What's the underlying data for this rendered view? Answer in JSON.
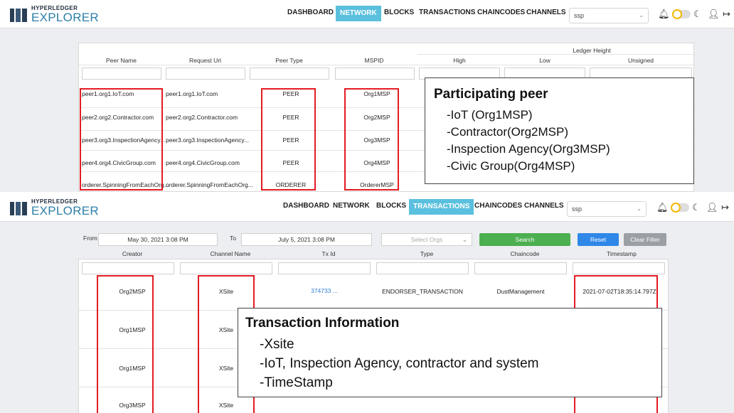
{
  "brand": {
    "top": "HYPERLEDGER",
    "bottom": "EXPLORER"
  },
  "nav": {
    "dashboard": "DASHBOARD",
    "network": "NETWORK",
    "blocks": "BLOCKS",
    "transactions": "TRANSACTIONS",
    "chaincodes": "CHAINCODES",
    "channels": "CHANNELS"
  },
  "channel_select": {
    "value": "ssp",
    "caret": "⌄"
  },
  "icons": [
    "bell-icon",
    "sun-icon",
    "theme-toggle",
    "moon-icon",
    "add-user-icon",
    "logout-icon"
  ],
  "colors": {
    "accent": "#5bc0de",
    "annotation_red": "#e31b23",
    "search_green": "#4caf50",
    "reset_blue": "#2f87e8",
    "clear_grey": "#9aa0a6",
    "link": "#2f7fd6"
  },
  "network": {
    "group_header": "Ledger Height",
    "columns": [
      "Peer Name",
      "Request Url",
      "Peer Type",
      "MSPID",
      "High",
      "Low",
      "Unsigned"
    ],
    "rows": [
      [
        "peer1.org1.IoT.com",
        "peer1.org1.IoT.com",
        "PEER",
        "Org1MSP"
      ],
      [
        "peer2.org2.Contractor.com",
        "peer2.org2.Contractor.com",
        "PEER",
        "Org2MSP"
      ],
      [
        "peer3.org3.InspectionAgency...",
        "peer3.org3.InspectionAgency...",
        "PEER",
        "Org3MSP"
      ],
      [
        "peer4.org4.CivicGroup.com",
        "peer4.org4.CivicGroup.com",
        "PEER",
        "Org4MSP"
      ],
      [
        "orderer.SpinningFromEachOrg...",
        "orderer.SpinningFromEachOrg...",
        "ORDERER",
        "OrdererMSP"
      ]
    ]
  },
  "callout_peer": {
    "title": "Participating  peer",
    "lines": [
      "-IoT (Org1MSP)",
      "-Contractor(Org2MSP)",
      "-Inspection  Agency(Org3MSP)",
      "-Civic Group(Org4MSP)"
    ]
  },
  "transactions": {
    "filter": {
      "from_label": "From",
      "from_value": "May 30, 2021 3:08 PM",
      "to_label": "To",
      "to_value": "July 5, 2021 3:08 PM",
      "orgs_placeholder": "Select Orgs",
      "search": "Search",
      "reset": "Reset",
      "clear": "Clear Filter"
    },
    "columns": [
      "Creator",
      "Channel Name",
      "Tx Id",
      "Type",
      "Chaincode",
      "Timestamp"
    ],
    "rows": [
      [
        "Org2MSP",
        "XSite",
        "374733 ...",
        "ENDORSER_TRANSACTION",
        "DustManagement",
        "2021-07-02T18:35:14.797Z"
      ],
      [
        "Org1MSP",
        "XSite"
      ],
      [
        "Org1MSP",
        "XSite"
      ],
      [
        "Org3MSP",
        "XSite"
      ]
    ]
  },
  "callout_tx": {
    "title": "Transaction  Information",
    "lines": [
      "-Xsite",
      "-IoT,  Inspection  Agency,  contractor  and  system",
      "-TimeStamp"
    ]
  }
}
